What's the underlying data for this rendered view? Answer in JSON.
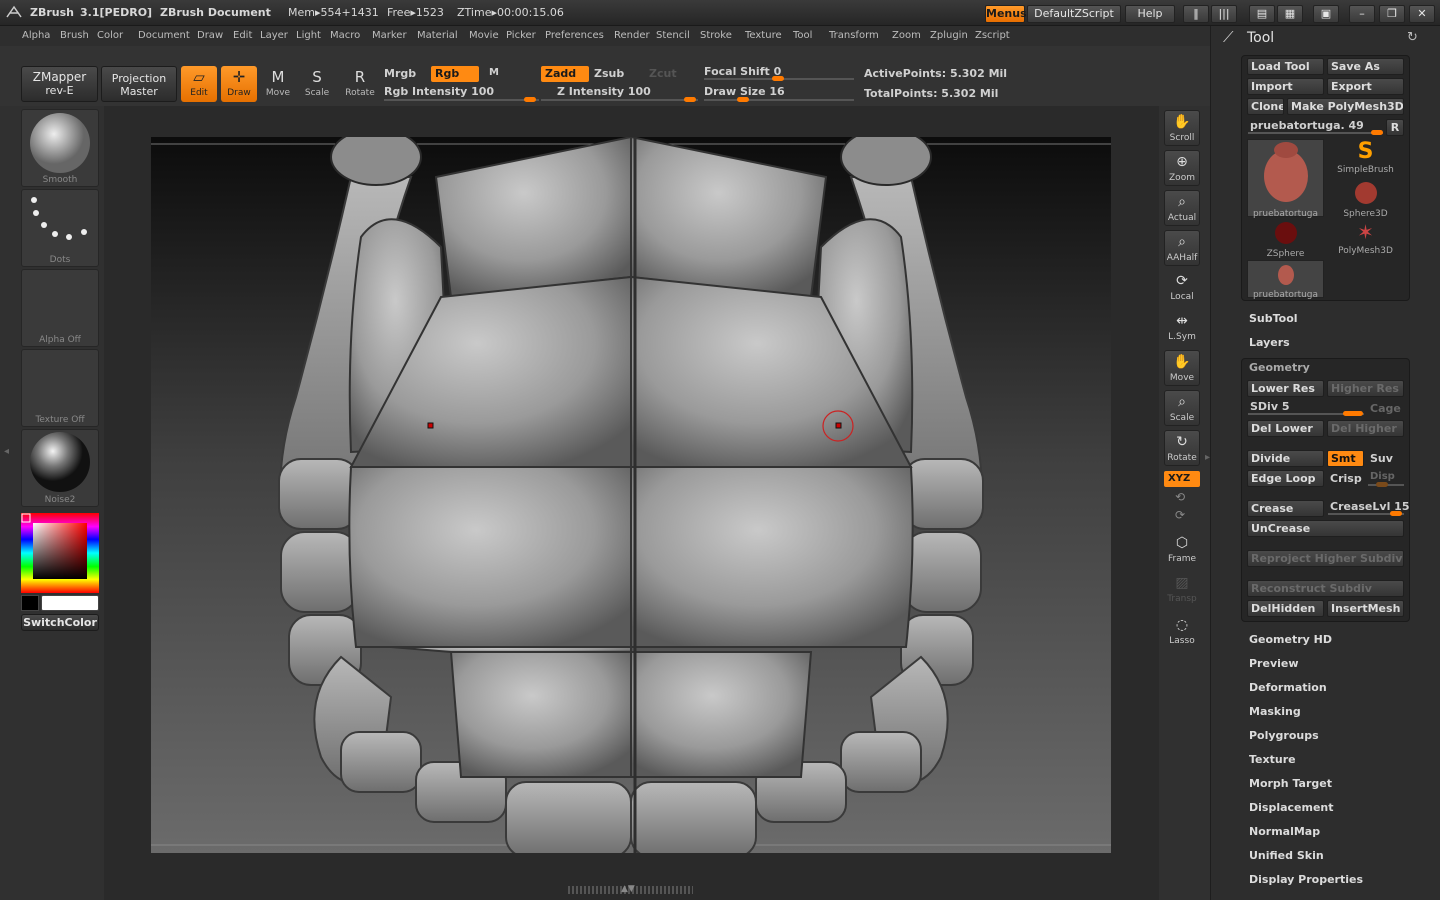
{
  "titlebar": {
    "app": "ZBrush",
    "version": "3.1[PEDRO]",
    "document": "ZBrush Document",
    "mem": "Mem▸554+1431",
    "free": "Free▸1523",
    "ztime": "ZTime▸00:00:15.06",
    "menus_btn": "Menus",
    "script_btn": "DefaultZScript",
    "help_btn": "Help"
  },
  "menubar": [
    "Alpha",
    "Brush",
    "Color",
    "Document",
    "Draw",
    "Edit",
    "Layer",
    "Light",
    "Macro",
    "Marker",
    "Material",
    "Movie",
    "Picker",
    "Preferences",
    "Render",
    "Stencil",
    "Stroke",
    "Texture",
    "Tool",
    "Transform",
    "Zoom",
    "Zplugin",
    "Zscript"
  ],
  "toolbar": {
    "zmapper": "ZMapper",
    "zmapper_sub": "rev-E",
    "projection": "Projection",
    "projection_sub": "Master",
    "edit": "Edit",
    "draw": "Draw",
    "move": "Move",
    "scale": "Scale",
    "rotate": "Rotate",
    "mrgb": "Mrgb",
    "rgb": "Rgb",
    "m": "M",
    "rgb_intensity": "Rgb Intensity 100",
    "zadd": "Zadd",
    "zsub": "Zsub",
    "zcut": "Zcut",
    "z_intensity": "Z Intensity 100",
    "focal_shift": "Focal Shift 0",
    "draw_size": "Draw Size 16",
    "active_points": "ActivePoints: 5.302 Mil",
    "total_points": "TotalPoints: 5.302 Mil"
  },
  "leftpanel": {
    "smooth": "Smooth",
    "dots": "Dots",
    "alpha_off": "Alpha Off",
    "texture_off": "Texture Off",
    "noise": "Noise2",
    "switch_color": "SwitchColor"
  },
  "righttools": [
    "Scroll",
    "Zoom",
    "Actual",
    "AAHalf",
    "Local",
    "L.Sym",
    "Move",
    "Scale",
    "Rotate",
    "Frame",
    "Transp",
    "Lasso"
  ],
  "xyz": "XYZ",
  "toolpalette": {
    "title": "Tool",
    "load_tool": "Load Tool",
    "save_as": "Save As",
    "import": "Import",
    "export": "Export",
    "clone": "Clone",
    "make_polymesh": "Make PolyMesh3D",
    "current_tool": "pruebatortuga. 49",
    "r": "R",
    "thumbs": [
      "pruebatortuga",
      "SimpleBrush",
      "Sphere3D",
      "ZSphere",
      "PolyMesh3D",
      "pruebatortuga"
    ],
    "subtool": "SubTool",
    "layers": "Layers",
    "geometry": "Geometry",
    "lower_res": "Lower Res",
    "higher_res": "Higher Res",
    "sdiv": "SDiv 5",
    "cage": "Cage",
    "del_lower": "Del Lower",
    "del_higher": "Del Higher",
    "divide": "Divide",
    "smt": "Smt",
    "suv": "Suv",
    "edge_loop": "Edge Loop",
    "crisp": "Crisp",
    "disp": "Disp",
    "crease": "Crease",
    "crease_lvl": "CreaseLvl 15",
    "uncrease": "UnCrease",
    "reproject": "Reproject Higher Subdiv",
    "reconstruct": "Reconstruct Subdiv",
    "delhidden": "DelHidden",
    "insertmesh": "InsertMesh",
    "sections": [
      "Geometry HD",
      "Preview",
      "Deformation",
      "Masking",
      "Polygroups",
      "Texture",
      "Morph Target",
      "Displacement",
      "NormalMap",
      "Unified Skin",
      "Display Properties"
    ]
  }
}
